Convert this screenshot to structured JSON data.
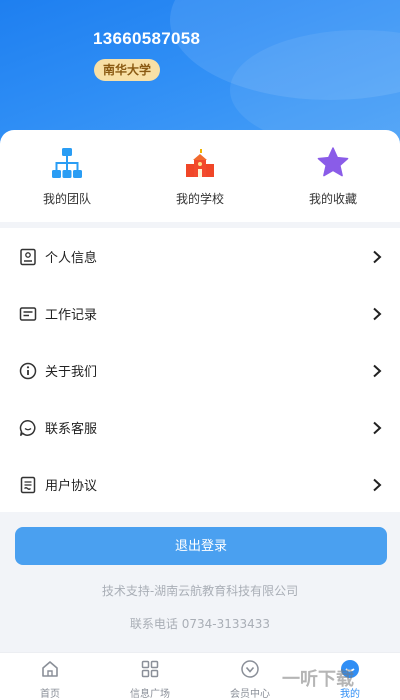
{
  "header": {
    "phone": "13660587058",
    "school": "南华大学"
  },
  "quick_actions": [
    {
      "label": "我的团队",
      "icon": "team-hierarchy-icon"
    },
    {
      "label": "我的学校",
      "icon": "school-building-icon"
    },
    {
      "label": "我的收藏",
      "icon": "star-icon"
    }
  ],
  "menu": [
    {
      "label": "个人信息",
      "icon": "id-card-icon"
    },
    {
      "label": "工作记录",
      "icon": "record-icon"
    },
    {
      "label": "关于我们",
      "icon": "info-icon"
    },
    {
      "label": "联系客服",
      "icon": "chat-icon"
    },
    {
      "label": "用户协议",
      "icon": "agreement-icon"
    }
  ],
  "logout_label": "退出登录",
  "footer": {
    "support": "技术支持-湖南云航教育科技有限公司",
    "phone": "联系电话 0734-3133433"
  },
  "tabbar": [
    {
      "label": "首页",
      "icon": "home-icon"
    },
    {
      "label": "信息广场",
      "icon": "grid-icon"
    },
    {
      "label": "会员中心",
      "icon": "member-icon"
    },
    {
      "label": "我的",
      "icon": "profile-icon",
      "active": true
    }
  ],
  "watermark": "一听下载",
  "colors": {
    "primary": "#2f8ef5",
    "button": "#4aa0f0",
    "badge_bg": "#f8e0a6",
    "badge_text": "#8a5a12"
  }
}
